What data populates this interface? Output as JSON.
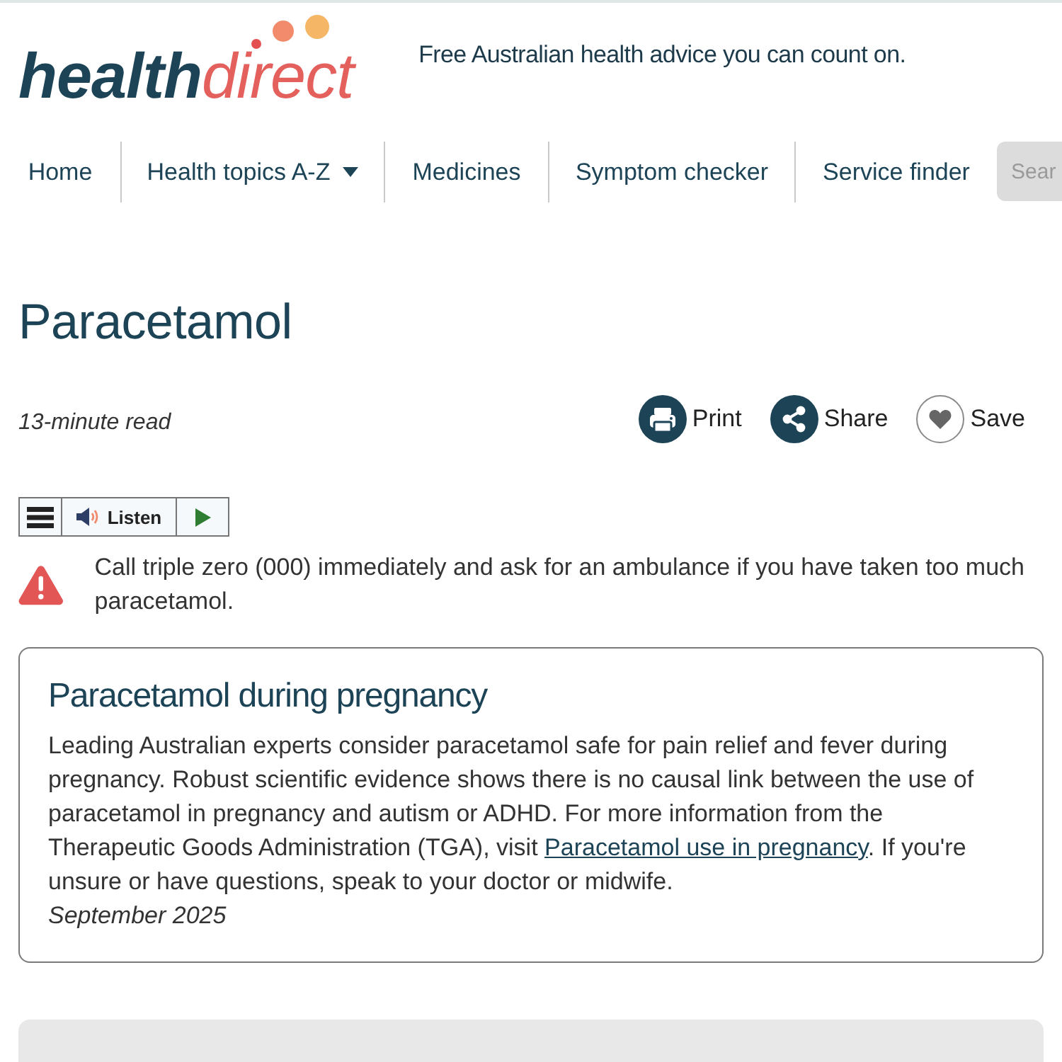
{
  "header": {
    "logo": {
      "first_part": "health",
      "second_part": "direct"
    },
    "tagline": "Free Australian health advice you can count on."
  },
  "nav": {
    "items": [
      {
        "label": "Home",
        "kind": "link"
      },
      {
        "label": "Health topics A-Z",
        "kind": "dropdown"
      },
      {
        "label": "Medicines",
        "kind": "link"
      },
      {
        "label": "Symptom checker",
        "kind": "link"
      },
      {
        "label": "Service finder",
        "kind": "link"
      }
    ],
    "search": {
      "placeholder": "Sear"
    }
  },
  "article": {
    "title": "Paracetamol",
    "read_time": "13-minute read",
    "actions": [
      {
        "label": "Print",
        "kind": "print"
      },
      {
        "label": "Share",
        "kind": "share"
      },
      {
        "label": "Save",
        "kind": "save"
      }
    ],
    "listen_bar": {
      "label": "Listen"
    },
    "alert": {
      "text": "Call triple zero (000) immediately and ask for an ambulance if you have taken too much paracetamol."
    },
    "notice": {
      "title": "Paracetamol during pregnancy",
      "text_before": "Leading Australian experts consider paracetamol safe for pain relief and fever during pregnancy. Robust scientific evidence shows there is no causal link between the use of paracetamol in pregnancy and autism or ADHD. For more information from the Therapeutic Goods Administration (TGA), visit ",
      "link": "Paracetamol use in pregnancy",
      "text_after": ". If you're unsure or have questions, speak to your doctor or midwife.",
      "date": "September 2025"
    }
  }
}
